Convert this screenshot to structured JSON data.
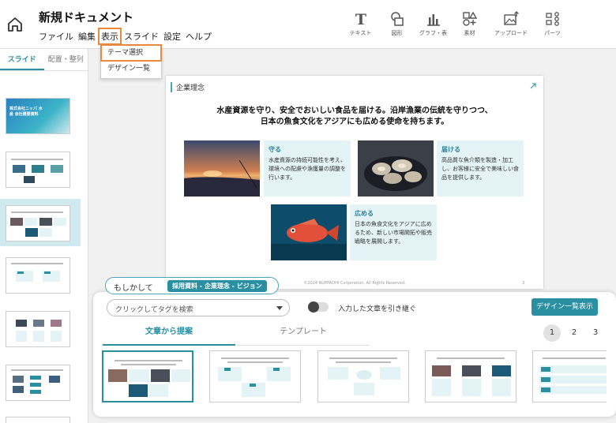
{
  "app": {
    "title": "新規ドキュメント"
  },
  "menu": {
    "items": [
      "ファイル",
      "編集",
      "表示",
      "スライド",
      "設定",
      "ヘルプ"
    ],
    "highlighted": "表示"
  },
  "view_menu": {
    "items": [
      "テーマ選択",
      "デザイン一覧"
    ],
    "highlighted": "テーマ選択"
  },
  "toolbar": {
    "items": [
      {
        "label": "テキスト",
        "icon": "text-icon"
      },
      {
        "label": "図形",
        "icon": "shapes-icon"
      },
      {
        "label": "グラフ・表",
        "icon": "chart-icon"
      },
      {
        "label": "素材",
        "icon": "assets-icon"
      },
      {
        "label": "アップロード",
        "icon": "upload-image-icon"
      },
      {
        "label": "パーツ",
        "icon": "parts-icon"
      }
    ]
  },
  "sidebar": {
    "tabs": [
      "スライド",
      "配置・整列"
    ],
    "active_tab": "スライド",
    "selected_slide": 3,
    "slide1_title": "株式会社ニッパ 水産 会社概要資料"
  },
  "slide": {
    "header": "企業理念",
    "main_line1": "水産資源を守り、安全でおいしい食品を届ける。沿岸漁業の伝統を守りつつ、",
    "main_line2": "日本の魚食文化をアジアにも広める使命を持ちます。",
    "boxes": [
      {
        "title": "守る",
        "text": "水産資源の持続可能性を考え、環境への配慮や漁獲量の調整を行います。"
      },
      {
        "title": "届ける",
        "text": "高品質な魚介類を製造・加工し、お客様に安全で美味しい食品を提供します。"
      },
      {
        "title": "広める",
        "text": "日本の魚食文化をアジアに広めるため、新しい市場開拓や販売戦略を展開します。"
      }
    ],
    "footer": "©2024 NUPPADHI Corporation. All Rights Reserved.",
    "page": "3"
  },
  "panel": {
    "suggest_label": "もしかして",
    "suggest_tag": "採用資料 - 企業理念 - ビジョン",
    "tag_placeholder": "クリックしてタグを検索",
    "toggle_label": "入力した文章を引き継ぐ",
    "toggle_on": false,
    "design_button": "デザイン一覧表示",
    "tabs": [
      "文章から提案",
      "テンプレート"
    ],
    "active_tab": "文章から提案",
    "pages": [
      "1",
      "2",
      "3"
    ],
    "current_page": "1"
  },
  "colors": {
    "accent": "#2a8fa0",
    "highlight": "#e8893d",
    "box": "#e3f3f6"
  }
}
